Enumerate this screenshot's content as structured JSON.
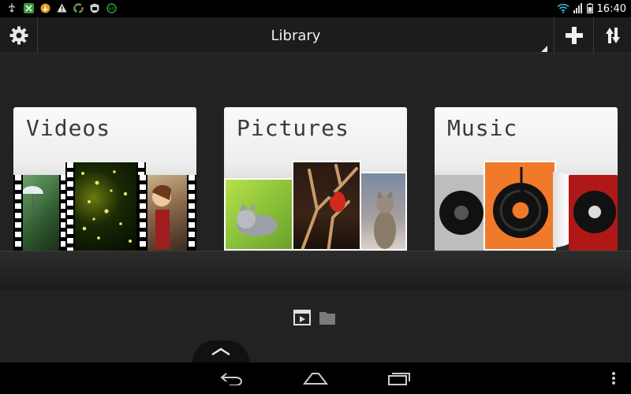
{
  "status_bar": {
    "time": "16:40",
    "left_icons": [
      "usb-icon",
      "android-debug-icon",
      "download-icon",
      "warning-icon",
      "sync-icon",
      "vpn-icon",
      "sd-icon"
    ],
    "right_icons": [
      "wifi-icon",
      "signal-icon",
      "battery-icon"
    ]
  },
  "action_bar": {
    "title": "Library",
    "settings_icon": "gear-icon",
    "add_icon": "plus-icon",
    "sort_icon": "sort-icon"
  },
  "library": {
    "tiles": [
      {
        "label": "Videos"
      },
      {
        "label": "Pictures"
      },
      {
        "label": "Music"
      }
    ]
  },
  "bottom": {
    "view_toggles": [
      "media-view-icon",
      "folder-view-icon"
    ],
    "drawer_icon": "chevron-up-icon"
  },
  "nav_bar": {
    "buttons": [
      "back-icon",
      "home-icon",
      "recents-icon",
      "overflow-menu-icon"
    ]
  },
  "colors": {
    "background": "#222222",
    "action_bar": "#1c1c1c",
    "music_accent": "#f07a2a"
  }
}
